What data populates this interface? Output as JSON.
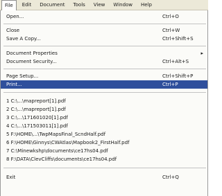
{
  "menubar": [
    "File",
    "Edit",
    "Document",
    "Tools",
    "View",
    "Window",
    "Help"
  ],
  "file_menu": {
    "open": {
      "label": "Open...",
      "shortcut": "Ctrl+O"
    },
    "close": {
      "label": "Close",
      "shortcut": "Ctrl+W"
    },
    "save_copy": {
      "label": "Save A Copy...",
      "shortcut": "Ctrl+Shift+S"
    },
    "doc_props": {
      "label": "Document Properties"
    },
    "doc_security": {
      "label": "Document Security...",
      "shortcut": "Ctrl+Alt+S"
    },
    "page_setup": {
      "label": "Page Setup...",
      "shortcut": "Ctrl+Shift+P"
    },
    "print": {
      "label": "Print...",
      "shortcut": "Ctrl+P"
    },
    "recent": [
      "1 C:\\...\\mapreport[1].pdf",
      "2 C:\\...\\mapreport[1].pdf",
      "3 C:\\...\\171601020[1].pdf",
      "4 C:\\...\\171503011[1].pdf",
      "5 F:\\HOME\\...\\TwpMapsFinal_ScndHalf.pdf",
      "6 F:\\HOME\\Ginnys\\CWAtlas\\Mapbook2_FirstHalf.pdf",
      "7 C:\\Minewkshp\\documents\\ce17hs04.pdf",
      "8 F:\\DATA\\ClevCliffs\\documents\\ce17hs04.pdf"
    ],
    "exit": {
      "label": "Exit",
      "shortcut": "Ctrl+Q"
    }
  }
}
